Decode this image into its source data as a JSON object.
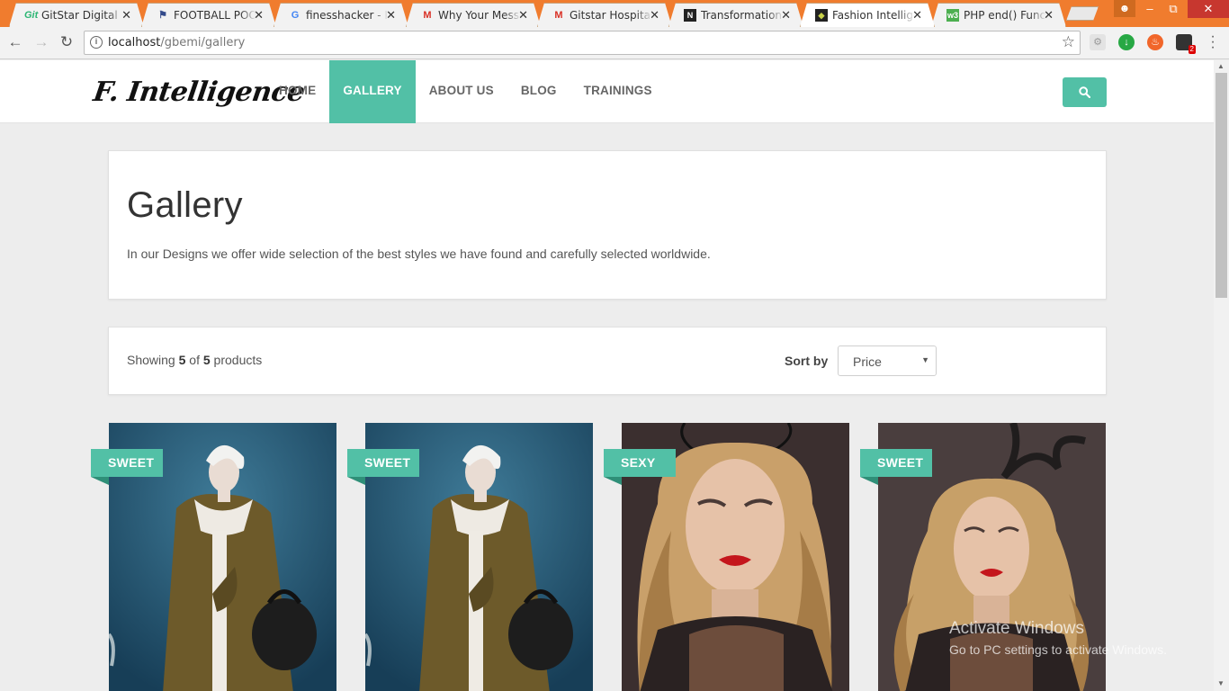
{
  "browser": {
    "tabs": [
      {
        "title": "GitStar Digital",
        "icon": "gitstar-icon",
        "active": false
      },
      {
        "title": "FOOTBALL POOL",
        "icon": "football-icon",
        "active": false
      },
      {
        "title": "finesshacker - Ic",
        "icon": "google-icon",
        "active": false
      },
      {
        "title": "Why Your Messa",
        "icon": "gmail-icon",
        "active": false
      },
      {
        "title": "Gitstar Hospitali",
        "icon": "gmail-icon",
        "active": false
      },
      {
        "title": "Transformation",
        "icon": "transformation-icon",
        "active": false
      },
      {
        "title": "Fashion Intellige",
        "icon": "fashion-icon",
        "active": true
      },
      {
        "title": "PHP end() Functi",
        "icon": "w3schools-icon",
        "active": false
      }
    ],
    "url_host": "localhost",
    "url_path": "/gbemi/gallery",
    "extension_badge": "2"
  },
  "site": {
    "logo": "F. Intelligence",
    "nav": [
      "HOME",
      "GALLERY",
      "ABOUT US",
      "BLOG",
      "TRAININGS"
    ],
    "active_nav": "GALLERY"
  },
  "hero": {
    "title": "Gallery",
    "description": "In our Designs we offer wide selection of the best styles we have found and carefully selected worldwide."
  },
  "filter": {
    "showing_prefix": "Showing",
    "shown": "5",
    "of": "of",
    "total": "5",
    "suffix": "products",
    "sort_label": "Sort by",
    "sort_value": "Price"
  },
  "products": [
    {
      "badge": "SWEET"
    },
    {
      "badge": "SWEET"
    },
    {
      "badge": "SEXY"
    },
    {
      "badge": "SWEET"
    }
  ],
  "watermark": {
    "line1": "Activate Windows",
    "line2": "Go to PC settings to activate Windows."
  },
  "colors": {
    "accent": "#52c0a6",
    "chrome_orange": "#f07c2e"
  }
}
